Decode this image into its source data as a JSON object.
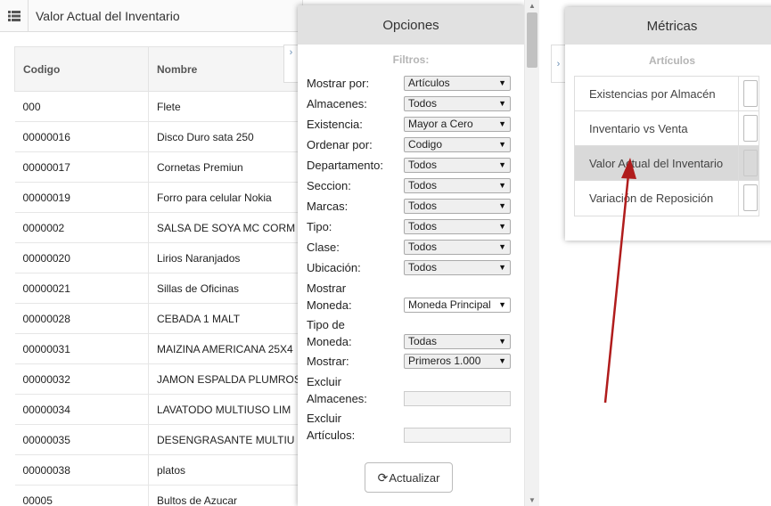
{
  "report": {
    "title": "Valor Actual del Inventario",
    "columns": {
      "code": "Codigo",
      "name": "Nombre"
    },
    "rows": [
      {
        "code": "000",
        "name": "Flete"
      },
      {
        "code": "00000016",
        "name": "Disco Duro sata 250"
      },
      {
        "code": "00000017",
        "name": "Cornetas Premiun"
      },
      {
        "code": "00000019",
        "name": "Forro para celular Nokia"
      },
      {
        "code": "0000002",
        "name": "SALSA DE SOYA MC CORM"
      },
      {
        "code": "00000020",
        "name": "Lirios Naranjados"
      },
      {
        "code": "00000021",
        "name": "Sillas de Oficinas"
      },
      {
        "code": "00000028",
        "name": "CEBADA 1 MALT"
      },
      {
        "code": "00000031",
        "name": "MAIZINA AMERICANA 25X4"
      },
      {
        "code": "00000032",
        "name": "JAMON ESPALDA PLUMROS"
      },
      {
        "code": "00000034",
        "name": "LAVATODO MULTIUSO LIM"
      },
      {
        "code": "00000035",
        "name": "DESENGRASANTE MULTIU"
      },
      {
        "code": "00000038",
        "name": "platos"
      },
      {
        "code": "00005",
        "name": "Bultos de Azucar"
      }
    ]
  },
  "options": {
    "title": "Opciones",
    "filters_heading": "Filtros:",
    "fields": {
      "mostrar_por": {
        "label": "Mostrar por:",
        "value": "Artículos"
      },
      "almacenes": {
        "label": "Almacenes:",
        "value": "Todos"
      },
      "existencia": {
        "label": "Existencia:",
        "value": "Mayor a Cero"
      },
      "ordenar_por": {
        "label": "Ordenar por:",
        "value": "Codigo"
      },
      "departamento": {
        "label": "Departamento:",
        "value": "Todos"
      },
      "seccion": {
        "label": "Seccion:",
        "value": "Todos"
      },
      "marcas": {
        "label": "Marcas:",
        "value": "Todos"
      },
      "tipo": {
        "label": "Tipo:",
        "value": "Todos"
      },
      "clase": {
        "label": "Clase:",
        "value": "Todos"
      },
      "ubicacion": {
        "label": "Ubicación:",
        "value": "Todos"
      },
      "mostrar_moneda": {
        "label_1": "Mostrar",
        "label_2": "Moneda:",
        "value": "Moneda Principal"
      },
      "tipo_moneda": {
        "label_1": "Tipo de",
        "label_2": "Moneda:",
        "value": "Todas"
      },
      "mostrar": {
        "label": "Mostrar:",
        "value": "Primeros 1.000"
      },
      "excluir_almacenes": {
        "label_1": "Excluir",
        "label_2": "Almacenes:",
        "value": ""
      },
      "excluir_articulos": {
        "label_1": "Excluir",
        "label_2": "Artículos:",
        "value": ""
      }
    },
    "update_button": "Actualizar"
  },
  "metrics": {
    "title": "Métricas",
    "section": "Artículos",
    "items": [
      {
        "label": "Existencias por Almacén"
      },
      {
        "label": "Inventario vs Venta"
      },
      {
        "label": "Valor Actual del Inventario"
      },
      {
        "label": "Variación de Reposición"
      }
    ],
    "selected_index": 2
  },
  "colors": {
    "arrow": "#b01c1c",
    "header_bg": "#e1e1e1",
    "selected_bg": "#d9d9d9"
  },
  "icons": {
    "menu": "list-icon",
    "refresh": "refresh-icon",
    "collapse": "chevron-right-icon"
  }
}
